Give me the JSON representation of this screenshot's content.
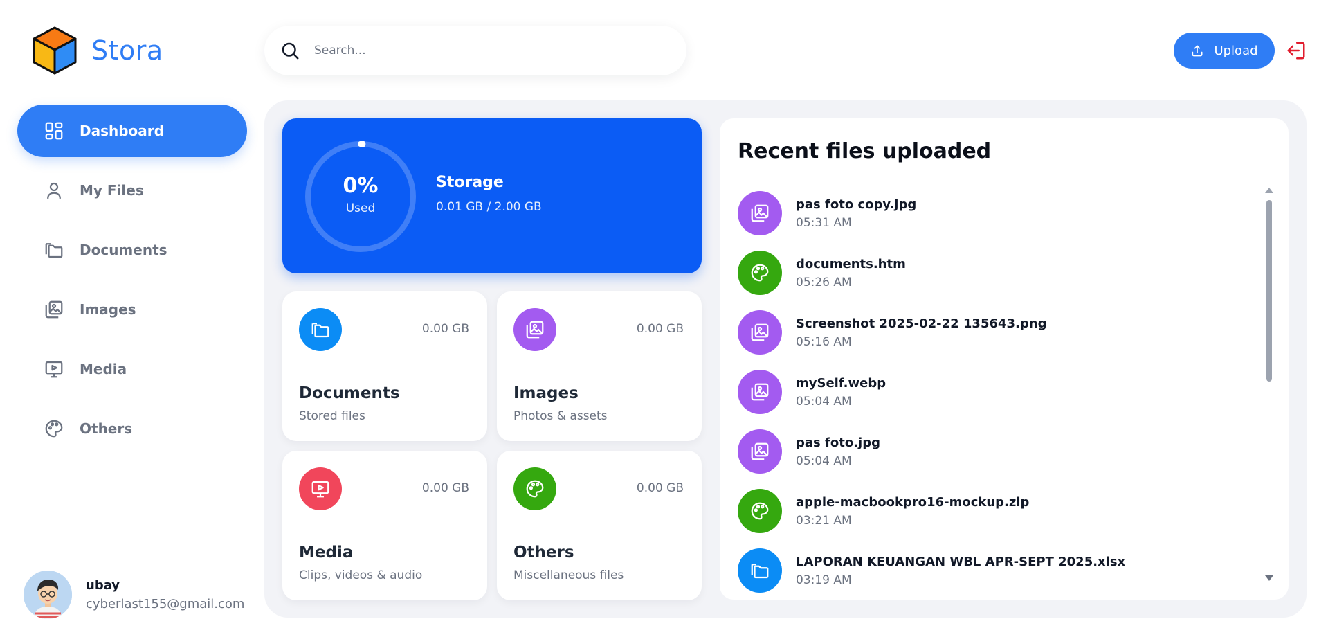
{
  "app": {
    "name": "Stora"
  },
  "search": {
    "placeholder": "Search..."
  },
  "header": {
    "upload_label": "Upload"
  },
  "sidebar": {
    "items": [
      {
        "label": "Dashboard",
        "icon": "grid-icon",
        "active": true
      },
      {
        "label": "My Files",
        "icon": "user-icon",
        "active": false
      },
      {
        "label": "Documents",
        "icon": "folders-icon",
        "active": false
      },
      {
        "label": "Images",
        "icon": "images-icon",
        "active": false
      },
      {
        "label": "Media",
        "icon": "monitor-play-icon",
        "active": false
      },
      {
        "label": "Others",
        "icon": "palette-icon",
        "active": false
      }
    ]
  },
  "user": {
    "name": "ubay",
    "email": "cyberlast155@gmail.com"
  },
  "storage": {
    "percent_label": "0%",
    "used_label": "Used",
    "title": "Storage",
    "usage": "0.01 GB / 2.00 GB",
    "used_fraction": 0.005
  },
  "categories": [
    {
      "name": "Documents",
      "desc": "Stored files",
      "size": "0.00 GB",
      "icon": "folders-icon",
      "color": "#0b8cf5"
    },
    {
      "name": "Images",
      "desc": "Photos & assets",
      "size": "0.00 GB",
      "icon": "images-icon",
      "color": "#a35bf0"
    },
    {
      "name": "Media",
      "desc": "Clips, videos & audio",
      "size": "0.00 GB",
      "icon": "monitor-play-icon",
      "color": "#f1465b"
    },
    {
      "name": "Others",
      "desc": "Miscellaneous files",
      "size": "0.00 GB",
      "icon": "palette-icon",
      "color": "#35a80f"
    }
  ],
  "recent": {
    "title": "Recent files uploaded",
    "files": [
      {
        "name": "pas foto copy.jpg",
        "time": "05:31 AM",
        "icon": "images-icon",
        "color": "#a35bf0"
      },
      {
        "name": "documents.htm",
        "time": "05:26 AM",
        "icon": "palette-icon",
        "color": "#35a80f"
      },
      {
        "name": "Screenshot 2025-02-22 135643.png",
        "time": "05:16 AM",
        "icon": "images-icon",
        "color": "#a35bf0"
      },
      {
        "name": "mySelf.webp",
        "time": "05:04 AM",
        "icon": "images-icon",
        "color": "#a35bf0"
      },
      {
        "name": "pas foto.jpg",
        "time": "05:04 AM",
        "icon": "images-icon",
        "color": "#a35bf0"
      },
      {
        "name": "apple-macbookpro16-mockup.zip",
        "time": "03:21 AM",
        "icon": "palette-icon",
        "color": "#35a80f"
      },
      {
        "name": "LAPORAN KEUANGAN WBL APR-SEPT 2025.xlsx",
        "time": "03:19 AM",
        "icon": "folders-icon",
        "color": "#0b8cf5"
      }
    ]
  },
  "colors": {
    "accent": "#2f7df5",
    "storage_card": "#0b5cf5",
    "logout": "#e11d2e"
  }
}
